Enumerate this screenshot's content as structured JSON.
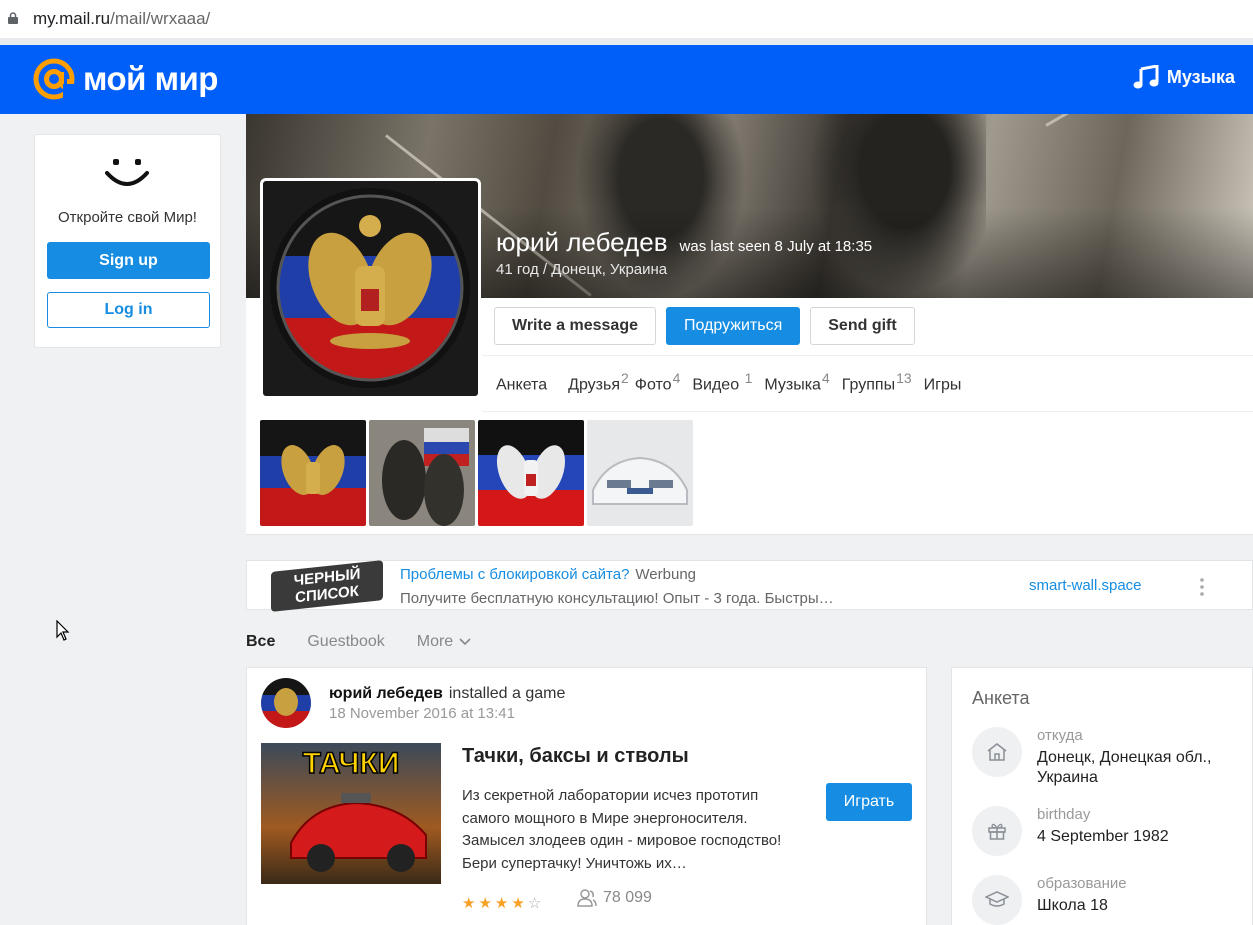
{
  "browser": {
    "url_host": "my.mail.ru",
    "url_path": "/mail/wrxaaa/"
  },
  "header": {
    "logo_text": "мой мир",
    "music_label": "Музыка",
    "brand_color": "#005ff9",
    "accent_color": "#168de2"
  },
  "left_card": {
    "invite": "Откройте свой Мир!",
    "signup_label": "Sign up",
    "login_label": "Log in"
  },
  "profile": {
    "name": "юрий лебедев",
    "last_seen": "was last seen 8 July at 18:35",
    "info": "41 год / Донецк, Украина",
    "actions": {
      "message": "Write a message",
      "friend": "Подружиться",
      "gift": "Send gift"
    },
    "tabs": [
      {
        "label": "Анкета",
        "count": ""
      },
      {
        "label": "Друзья",
        "count": "2"
      },
      {
        "label": "Фото",
        "count": "4"
      },
      {
        "label": "Видео",
        "count": "1"
      },
      {
        "label": "Музыка",
        "count": "4"
      },
      {
        "label": "Группы",
        "count": "13"
      },
      {
        "label": "Игры",
        "count": ""
      }
    ]
  },
  "ad": {
    "logo_text": "ЧЕРНЫЙ СПИСОК",
    "title": "Проблемы с блокировкой сайта?",
    "tag": "Werbung",
    "description": "Получите бесплатную консультацию! Опыт - 3 года. Быстры…",
    "link": "smart-wall.space"
  },
  "feed_tabs": {
    "all": "Все",
    "guestbook": "Guestbook",
    "more": "More"
  },
  "post": {
    "author": "юрий лебедев",
    "action": "installed a game",
    "date": "18 November 2016 at 13:41",
    "game_logo": "ТАЧКИ",
    "game_title": "Тачки, баксы и стволы",
    "game_description": "Из секретной лаборатории исчез прототип самого мощного в Мире энергоносителя. Замысел злодеев один - мировое господство! Бери супертачку! Уничтожь их…",
    "play_label": "Играть",
    "rating": 4,
    "rating_max": 5,
    "players": "78 099"
  },
  "anketa": {
    "title": "Анкета",
    "rows": [
      {
        "label": "откуда",
        "value": "Донецк, Донецкая обл., Украина",
        "icon": "house-icon"
      },
      {
        "label": "birthday",
        "value": "4 September 1982",
        "icon": "gift-icon"
      },
      {
        "label": "образование",
        "value": "Школа 18",
        "icon": "graduation-cap-icon"
      }
    ]
  }
}
